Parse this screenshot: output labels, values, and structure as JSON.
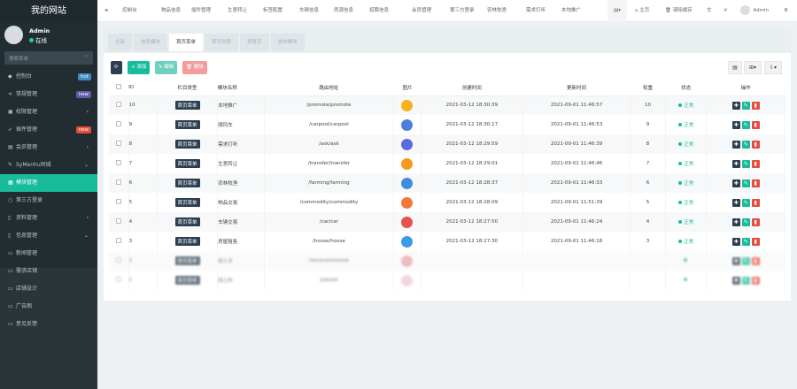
{
  "sidebar": {
    "logo": "我的网站",
    "user": "Admin",
    "status": "在线",
    "search_placeholder": "搜索菜单",
    "items": [
      {
        "icon": "dashboard-icon",
        "label": "控制台",
        "badge": "hot",
        "badge_color": "#3c8dbc"
      },
      {
        "icon": "share-icon",
        "label": "常规管理",
        "badge": "new",
        "badge_color": "#605ca8"
      },
      {
        "icon": "users-icon",
        "label": "权限管理",
        "arrow": "‹"
      },
      {
        "icon": "rocket-icon",
        "label": "插件管理",
        "badge": "new",
        "badge_color": "#e74c3c"
      },
      {
        "icon": "user-card-icon",
        "label": "会员管理",
        "arrow": "‹"
      },
      {
        "icon": "magic-icon",
        "label": "SyMenhu同城",
        "arrow": "⌄"
      },
      {
        "icon": "module-icon",
        "label": "模块管理",
        "active": true
      },
      {
        "icon": "circle-icon",
        "label": "第三方登录"
      },
      {
        "icon": "file-icon",
        "label": "资料管理",
        "arrow": "‹"
      },
      {
        "icon": "file-icon",
        "label": "信息管理",
        "arrow": "⌄"
      },
      {
        "icon": "list-icon",
        "label": "新闻管理"
      },
      {
        "icon": "list-icon",
        "label": "需求店铺"
      },
      {
        "icon": "list-icon",
        "label": "店铺设计"
      },
      {
        "icon": "list-icon",
        "label": "广告图"
      },
      {
        "icon": "list-icon",
        "label": "意见反馈"
      }
    ]
  },
  "topnav": {
    "items": [
      "控制台",
      "物品信息",
      "插件管理",
      "生意转让",
      "标签配置",
      "车辆信息",
      "房源信息",
      "招聘信息",
      "会员管理",
      "第三方登录",
      "农林牧渔",
      "需求打听",
      "本地推广"
    ],
    "home": "主页",
    "clear_cache": "清除缓存",
    "user": "Admin"
  },
  "tabs": [
    {
      "label": "全部"
    },
    {
      "label": "信息模块"
    },
    {
      "label": "首页菜单",
      "active": true
    },
    {
      "label": "首页列表"
    },
    {
      "label": "搭客页"
    },
    {
      "label": "发布模块"
    }
  ],
  "toolbar": {
    "add": "+ 添加",
    "edit": "✎ 编辑",
    "delete": "🗑 删除"
  },
  "table": {
    "headers": [
      "ID",
      "栏目类型",
      "模块名称",
      "路由地址",
      "图片",
      "创建时间",
      "更新时间",
      "权重",
      "状态",
      "操作"
    ],
    "rows": [
      {
        "id": "10",
        "type": "首页菜单",
        "name": "本地推广",
        "route": "/promote/promote",
        "color": "#f5b21a",
        "created": "2021-03-12 18:30:39",
        "updated": "2021-09-01 11:46:57",
        "weight": "10",
        "status": "正常"
      },
      {
        "id": "9",
        "type": "首页菜单",
        "name": "顺风车",
        "route": "/carpool/carpool",
        "color": "#4a7fe0",
        "created": "2021-03-12 18:30:17",
        "updated": "2021-09-01 11:46:53",
        "weight": "9",
        "status": "正常"
      },
      {
        "id": "8",
        "type": "首页菜单",
        "name": "需求打听",
        "route": "/ask/ask",
        "color": "#5b6ae0",
        "created": "2021-03-12 18:29:59",
        "updated": "2021-09-01 11:46:39",
        "weight": "8",
        "status": "正常"
      },
      {
        "id": "7",
        "type": "首页菜单",
        "name": "生意转让",
        "route": "/transfer/transfer",
        "color": "#f59a1a",
        "created": "2021-03-12 18:29:01",
        "updated": "2021-09-01 11:46:46",
        "weight": "7",
        "status": "正常"
      },
      {
        "id": "6",
        "type": "首页菜单",
        "name": "农林牧渔",
        "route": "/farming/farming",
        "color": "#3f8de0",
        "created": "2021-03-12 18:28:37",
        "updated": "2021-09-01 11:46:33",
        "weight": "6",
        "status": "正常"
      },
      {
        "id": "5",
        "type": "首页菜单",
        "name": "物品交易",
        "route": "/commodity/commodity",
        "color": "#f5763a",
        "created": "2021-03-12 18:28:09",
        "updated": "2021-09-01 11:51:39",
        "weight": "5",
        "status": "正常"
      },
      {
        "id": "4",
        "type": "首页菜单",
        "name": "车辆交易",
        "route": "/car/car",
        "color": "#e9504f",
        "created": "2021-03-12 18:27:50",
        "updated": "2021-09-01 11:46:24",
        "weight": "4",
        "status": "正常"
      },
      {
        "id": "3",
        "type": "首页菜单",
        "name": "房屋租售",
        "route": "/house/house",
        "color": "#3a9be8",
        "created": "2021-03-12 18:27:30",
        "updated": "2021-09-01 11:46:18",
        "weight": "3",
        "status": "正常"
      },
      {
        "id": "2",
        "type": "首页菜单",
        "name": "找人才",
        "route": "/resume/resume",
        "color": "#e8a0a8",
        "created": "",
        "updated": "",
        "weight": "",
        "status": "",
        "blurred": true
      },
      {
        "id": "1",
        "type": "首页菜单",
        "name": "找工作",
        "route": "/job/job",
        "color": "#f0c4cc",
        "created": "",
        "updated": "",
        "weight": "",
        "status": "",
        "blurred": true
      }
    ]
  }
}
